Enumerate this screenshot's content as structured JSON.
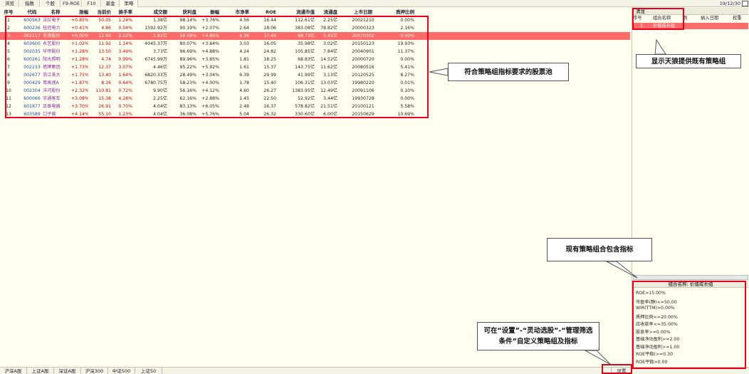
{
  "top_tabs": [
    "浏览",
    "指数",
    "个股",
    "F9-ROE",
    "F10",
    "基金",
    "策略"
  ],
  "date": "19/12/30",
  "columns": [
    "序号",
    "代码",
    "名称",
    "涨幅",
    "当前价",
    "换手率",
    "成交额",
    "获利盘",
    "振幅",
    "市净率",
    "ROE",
    "流通市值",
    "流通盘",
    "上市日期",
    "质押比例"
  ],
  "rows": [
    [
      "1",
      "600563",
      "法拉电子",
      "+0.85%",
      "50.05",
      "1.24%",
      "1.38亿",
      "98.14%",
      "+3.76%",
      "4.56",
      "16.44",
      "112.61亿",
      "2.25亿",
      "20021210",
      "0.00%"
    ],
    [
      "2",
      "600236",
      "桂冠电力",
      "+0.41%",
      "4.86",
      "0.04%",
      "1592.92万",
      "90.19%",
      "+2.07%",
      "2.64",
      "18.06",
      "383.08亿",
      "78.82亿",
      "20000323",
      "2.16%"
    ],
    [
      "3",
      "002117",
      "东港股份",
      "+0.00%",
      "12.60",
      "2.52%",
      "1.82亿",
      "56.59%",
      "+4.86%",
      "4.36",
      "17.40",
      "68.73亿",
      "5.45亿",
      "20070302",
      "0.00%"
    ],
    [
      "4",
      "603600",
      "永艺股份",
      "+1.02%",
      "11.92",
      "1.14%",
      "4045.37万",
      "80.07%",
      "+3.64%",
      "3.03",
      "16.05",
      "35.98亿",
      "3.02亿",
      "20150123",
      "19.93%"
    ],
    [
      "5",
      "002035",
      "华帝股份",
      "+1.28%",
      "13.50",
      "3.49%",
      "3.73亿",
      "96.69%",
      "+4.88%",
      "4.24",
      "24.82",
      "105.85亿",
      "7.84亿",
      "20040901",
      "11.37%"
    ],
    [
      "6",
      "600261",
      "阳光照明",
      "+1.28%",
      "4.74",
      "0.99%",
      "6745.99万",
      "89.96%",
      "+3.85%",
      "1.81",
      "18.25",
      "68.83亿",
      "14.52亿",
      "20000720",
      "0.00%"
    ],
    [
      "7",
      "002233",
      "塔牌集团",
      "+1.73%",
      "12.37",
      "3.07%",
      "4.46亿",
      "95.22%",
      "+5.92%",
      "1.61",
      "15.37",
      "143.75亿",
      "11.62亿",
      "20080516",
      "5.41%"
    ],
    [
      "8",
      "002677",
      "浙江美大",
      "+1.75%",
      "13.40",
      "1.64%",
      "6820.33万",
      "28.49%",
      "+3.04%",
      "6.39",
      "29.99",
      "41.99亿",
      "3.13亿",
      "20120525",
      "8.27%"
    ],
    [
      "9",
      "000429",
      "粤高速A",
      "+1.87%",
      "8.16",
      "0.64%",
      "6780.75万",
      "58.23%",
      "+4.00%",
      "1.78",
      "15.40",
      "106.31亿",
      "13.03亿",
      "19980220",
      "0.01%"
    ],
    [
      "10",
      "002304",
      "洋河股份",
      "+2.32%",
      "110.81",
      "0.72%",
      "9.90亿",
      "56.16%",
      "+4.12%",
      "4.60",
      "26.27",
      "1383.95亿",
      "12.49亿",
      "20091106",
      "0.10%"
    ],
    [
      "11",
      "600066",
      "宇通客车",
      "+3.08%",
      "15.38",
      "4.28%",
      "2.25亿",
      "62.16%",
      "+2.88%",
      "1.45",
      "22.50",
      "52.92亿",
      "3.44亿",
      "19930728",
      "0.00%"
    ],
    [
      "12",
      "601877",
      "正泰电器",
      "+3.70%",
      "26.91",
      "0.70%",
      "4.04亿",
      "83.13%",
      "+6.05%",
      "2.48",
      "16.37",
      "578.82亿",
      "21.51亿",
      "20100121",
      "5.58%"
    ],
    [
      "13",
      "603589",
      "口子窖",
      "+4.14%",
      "55.10",
      "1.23%",
      "4.04亿",
      "36.08%",
      "+5.76%",
      "5.04",
      "26.32",
      "330.60亿",
      "6.00亿",
      "20150629",
      "10.69%"
    ]
  ],
  "selected_row": 2,
  "right_panel": {
    "title": "清龙",
    "headers": [
      "序号",
      "组合名称",
      "例",
      "纳入日期",
      "权重"
    ],
    "row": [
      "1",
      "价值成长组"
    ],
    "indicator_title": "组合名称: 价值成长组",
    "indicators": [
      "ROE>15.00%",
      "市盈率(静)<=50.00",
      "WIR(TTM)>0.00%",
      "质押比例<=20.00%",
      "应收款率<=35.00%",
      "股息率>=0.00%",
      "基础净动盈利>=2.00",
      "基础净动盈利>=1.00",
      "ROE平稳(>=0.30",
      "ROE平稳>0.00"
    ]
  },
  "bottom_tabs": [
    "沪深A股",
    "上证A股",
    "深证A股",
    "沪深300",
    "中证500",
    "上证50"
  ],
  "settings_label": "设置",
  "callouts": {
    "stock_pool": "符合策略组指标要求的股票池",
    "existing_group": "显示天狼提供既有策略组",
    "contains_indicators": "现有策略组合包含指标",
    "customize": "可在“设置”-“灵动选股”-“管理筛选条件”自定义策略组及指标"
  },
  "colors": {
    "accent_red": "#e8001c",
    "selected_row": "#ff6b6b",
    "background": "#fffff0"
  }
}
